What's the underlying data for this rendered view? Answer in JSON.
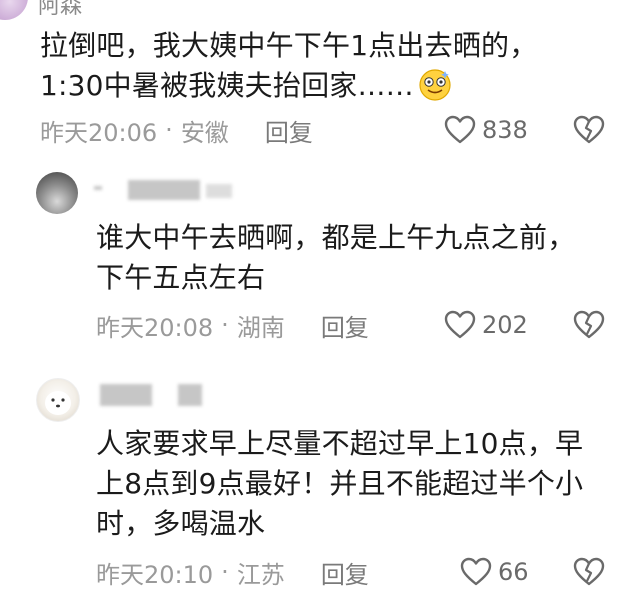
{
  "comments": [
    {
      "id": "c1",
      "username": "阿森",
      "text_lines": [
        "拉倒吧，我大姨中午下午1点出去晒的，",
        "1:30中暑被我姨夫抬回家……"
      ],
      "time": "昨天20:06",
      "location": "安徽",
      "reply_label": "回复",
      "likes": "838",
      "emoji_icon": "dizzy-smile-emoji"
    },
    {
      "id": "c2",
      "text_lines": [
        "谁大中午去晒啊，都是上午九点之前，",
        "下午五点左右"
      ],
      "time": "昨天20:08",
      "location": "湖南",
      "reply_label": "回复",
      "likes": "202"
    },
    {
      "id": "c3",
      "text_lines": [
        "人家要求早上尽量不超过早上10点，早",
        "上8点到9点最好！并且不能超过半个小",
        "时，多喝温水"
      ],
      "time": "昨天20:10",
      "location": "江苏",
      "reply_label": "回复",
      "likes": "66"
    }
  ],
  "separator": "·",
  "icons": {
    "like": "heart-outline-icon",
    "dislike": "broken-heart-icon"
  },
  "colors": {
    "text": "#1b1b1b",
    "meta": "#9a9a9a",
    "icon": "#6a6a6a"
  }
}
